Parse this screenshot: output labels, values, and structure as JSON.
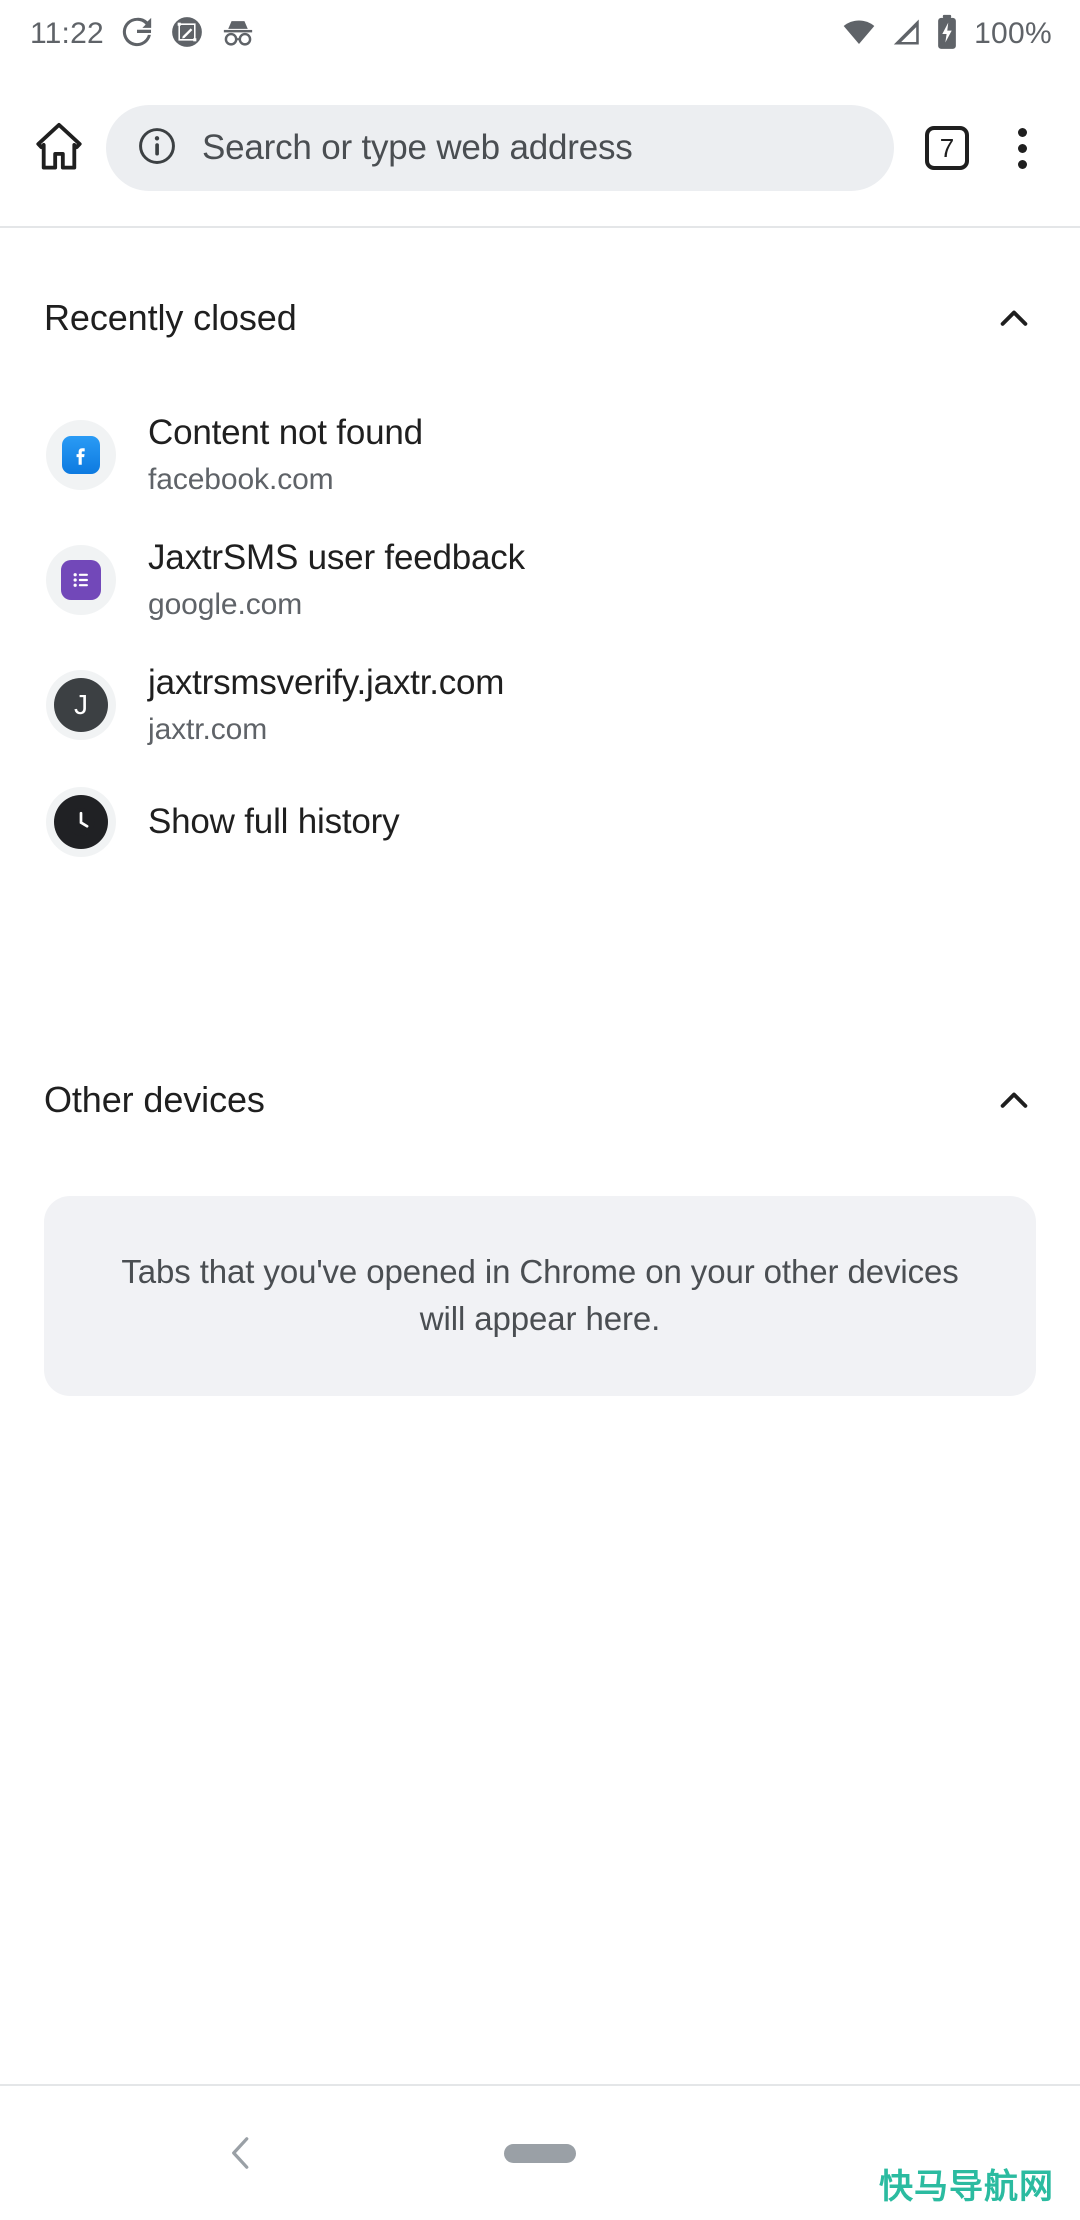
{
  "status_bar": {
    "time": "11:22",
    "battery_percent": "100%",
    "icons": [
      "google-icon",
      "screenshot-markup-icon",
      "incognito-icon",
      "wifi-icon",
      "cellular-signal-icon",
      "battery-charging-icon"
    ]
  },
  "toolbar": {
    "home_label": "Home",
    "omnibox_placeholder": "Search or type web address",
    "omnibox_value": "",
    "tab_count": "7",
    "menu_label": "More options"
  },
  "sections": [
    {
      "id": "recently-closed",
      "title": "Recently closed",
      "expanded": true,
      "chevron": "chevron-up-icon"
    },
    {
      "id": "other-devices",
      "title": "Other devices",
      "expanded": true,
      "chevron": "chevron-up-icon"
    }
  ],
  "recently_closed": {
    "items": [
      {
        "title": "Content not found",
        "domain": "facebook.com",
        "icon": "facebook-favicon",
        "icon_letter": "f"
      },
      {
        "title": "JaxtrSMS user feedback",
        "domain": "google.com",
        "icon": "google-forms-favicon",
        "icon_letter": ""
      },
      {
        "title": "jaxtrsmsverify.jaxtr.com",
        "domain": "jaxtr.com",
        "icon": "letter-favicon",
        "icon_letter": "J"
      }
    ],
    "show_full_history": {
      "label": "Show full history",
      "icon": "clock-icon"
    }
  },
  "other_devices": {
    "empty_message": "Tabs that you've opened in Chrome on your other devices will appear here."
  },
  "navigation_bar": {
    "back_label": "Back",
    "home_label": "Home",
    "icons": [
      "back-chevron-icon",
      "home-pill-icon"
    ]
  },
  "watermark": {
    "text": "快马导航网",
    "color": "#2bbba0"
  },
  "colors": {
    "omnibox_background": "#eceef1",
    "card_background": "#f1f2f5",
    "favicon_circle": "#f1f3f4",
    "primary_text": "#1f1f1f",
    "secondary_text": "#5f6368",
    "facebook_blue": "#1877f2",
    "forms_purple": "#7248b9"
  }
}
